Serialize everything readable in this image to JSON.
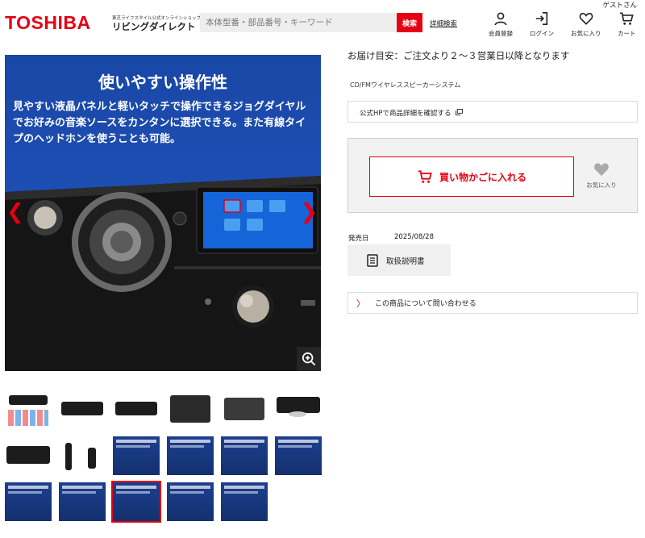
{
  "header": {
    "logo": "TOSHIBA",
    "shop_subtitle": "東芝ライフスタイル公式オンラインショップ",
    "shop_name": "リビングダイレクト",
    "search_placeholder": "本体型番・部品番号・キーワード",
    "search_button": "検索",
    "advanced_search": "詳細検索",
    "guest_label": "ゲストさん",
    "nav": [
      {
        "label": "会員登録",
        "icon": "person-icon"
      },
      {
        "label": "ログイン",
        "icon": "login-icon"
      },
      {
        "label": "お気に入り",
        "icon": "heart-icon"
      },
      {
        "label": "カート",
        "icon": "cart-icon"
      }
    ]
  },
  "gallery": {
    "banner_title": "使いやすい操作性",
    "banner_description": "見やすい液晶パネルと軽いタッチで操作できるジョグダイヤルでお好みの音楽ソースをカンタンに選択できる。また有線タイプのヘッドホンを使うことも可能。",
    "thumbnail_count": 17,
    "selected_thumbnail": 14
  },
  "product": {
    "delivery_note": "お届け目安：ご注文より２〜３営業日以降となります",
    "product_type": "CD/FMワイヤレススピーカーシステム",
    "official_hp_link": "公式HPで商品詳細を確認する",
    "add_to_cart": "買い物かごに入れる",
    "favorite": "お気に入り",
    "release_label": "発売日",
    "release_date": "2025/08/28",
    "manual_button": "取扱説明書",
    "inquiry_link": "この商品について問い合わせる"
  },
  "colors": {
    "brand_red": "#e60012",
    "banner_blue": "#1d4fb4"
  }
}
